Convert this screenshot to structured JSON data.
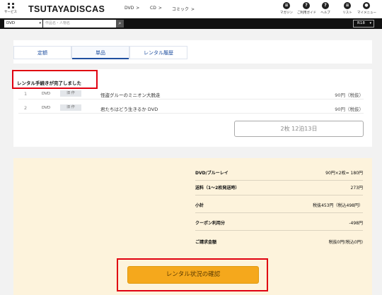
{
  "header": {
    "service_label": "サービス",
    "logo_text": "TSUTAYADISCAS",
    "nav": [
      {
        "label": "DVD",
        "chevron": ">"
      },
      {
        "label": "CD",
        "chevron": ">"
      },
      {
        "label": "コミック",
        "chevron": ">"
      }
    ],
    "icons": [
      {
        "icon": "book-icon",
        "label": "マガジン",
        "glyph": "≡"
      },
      {
        "icon": "guide-icon",
        "label": "ご利用ガイド",
        "glyph": "?"
      },
      {
        "icon": "help-icon",
        "label": "ヘルプ",
        "glyph": "?"
      },
      {
        "icon": "list-icon",
        "label": "リスト",
        "glyph": "≡"
      },
      {
        "icon": "user-icon",
        "label": "マイメニュー",
        "glyph": "●"
      }
    ]
  },
  "search": {
    "category": "DVD",
    "placeholder": "作品名・人物名",
    "button_glyph": "⌕",
    "r18_label": "R18",
    "dropdown_glyph": "▾"
  },
  "tabs": [
    {
      "label": "定額"
    },
    {
      "label": "単品"
    },
    {
      "label": "レンタル履歴"
    }
  ],
  "order": {
    "complete_message": "レンタル手続きが完了しました",
    "items": [
      {
        "num": "1",
        "format": "DVD",
        "badge": "旧 作",
        "title": "怪盗グルーのミニオン大脱走",
        "price": "90円（税抜）"
      },
      {
        "num": "2",
        "format": "DVD",
        "badge": "旧 作",
        "title": "君たちはどう生きるか DVD",
        "price": "90円（税抜）"
      }
    ],
    "period_button": "2枚 12泊13日"
  },
  "summary": {
    "lines": [
      {
        "key": "DVD/ブルーレイ",
        "value": "90円×2枚= 180円"
      },
      {
        "key": "送料（1〜2枚発送時）",
        "value": "273円"
      },
      {
        "key": "小計",
        "value": "税抜453円（税込498円）"
      },
      {
        "key": "クーポン利用分",
        "value": "-498円"
      },
      {
        "key": "ご請求金額",
        "value": "税抜0円(税込0円)"
      }
    ],
    "cta_label": "レンタル状況の確認"
  },
  "colors": {
    "accent_blue": "#1f4fa0",
    "highlight_red": "#e00010",
    "cta_orange": "#f5a81c",
    "summary_bg": "#fdf3dc"
  }
}
